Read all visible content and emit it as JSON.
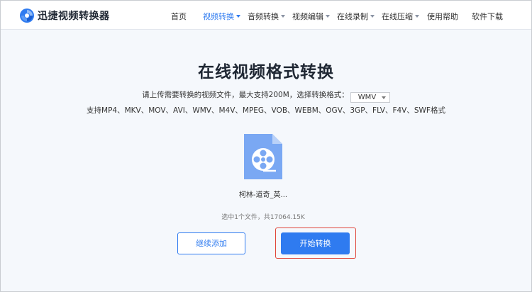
{
  "header": {
    "logo_text": "迅捷视频转换器",
    "nav": [
      {
        "label": "首页",
        "has_caret": false,
        "active": false
      },
      {
        "label": "视频转换",
        "has_caret": true,
        "active": true
      },
      {
        "label": "音频转换",
        "has_caret": true,
        "active": false
      },
      {
        "label": "视频编辑",
        "has_caret": true,
        "active": false
      },
      {
        "label": "在线录制",
        "has_caret": true,
        "active": false
      },
      {
        "label": "在线压缩",
        "has_caret": true,
        "active": false
      },
      {
        "label": "使用帮助",
        "has_caret": false,
        "active": false
      },
      {
        "label": "软件下载",
        "has_caret": false,
        "active": false
      }
    ]
  },
  "main": {
    "title": "在线视频格式转换",
    "hint": "请上传需要转换的视频文件，最大支持200M，选择转换格式：",
    "format_selected": "WMV",
    "formats_text": "支持MP4、MKV、MOV、AVI、WMV、M4V、MPEG、VOB、WEBM、OGV、3GP、FLV、F4V、SWF格式",
    "file": {
      "name": "柯林-道奇_英...",
      "icon": "video-file-icon"
    },
    "selected_info": "选中1个文件，共17064.15K",
    "add_button": "继续添加",
    "start_button": "开始转换"
  },
  "colors": {
    "accent": "#2f7bf0",
    "highlight": "#e0453a",
    "background": "#f5f8fc"
  }
}
